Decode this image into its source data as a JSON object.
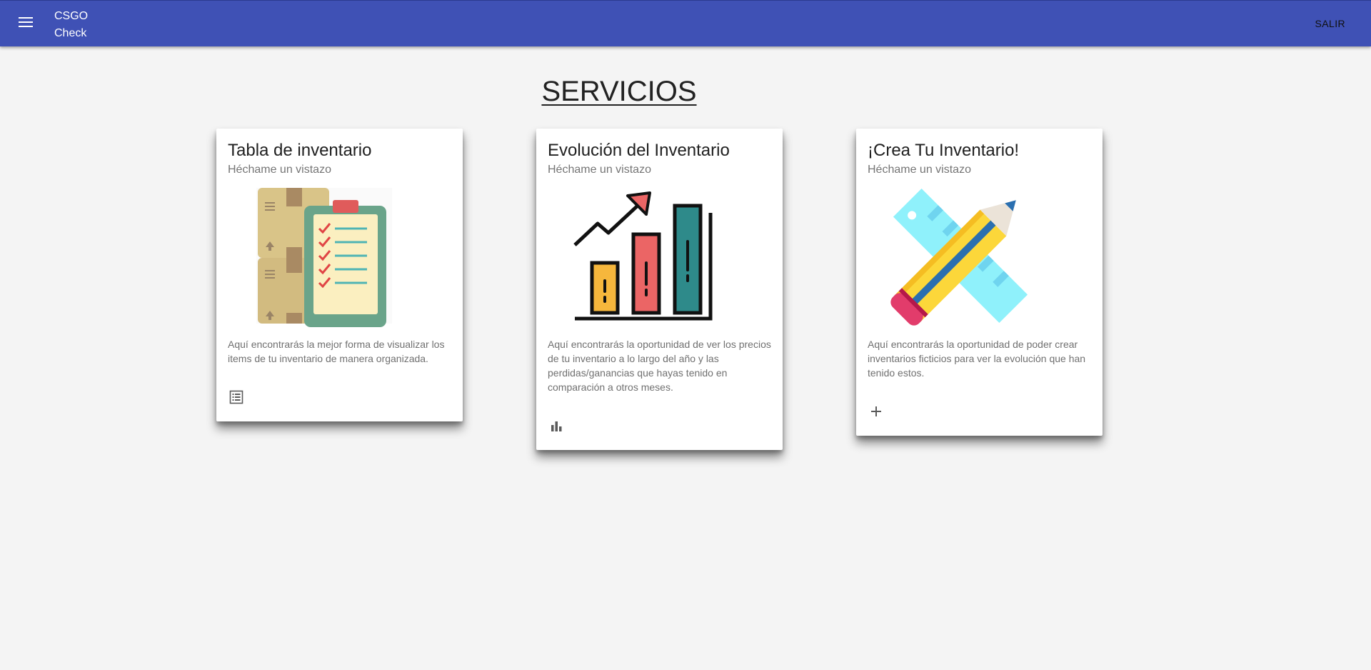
{
  "app": {
    "brand_line1": "CSGO",
    "brand_line2": "Check",
    "logout_label": "SALIR",
    "primary_color": "#3f51b5"
  },
  "page": {
    "title": "SERVICIOS"
  },
  "cards": [
    {
      "title": "Tabla de inventario",
      "subtitle": "Héchame un vistazo",
      "description": "Aquí encontrarás la mejor forma de visualizar los items de tu inventario de manera organizada.",
      "image": "boxes-clipboard-checklist",
      "action_icon": "list-icon"
    },
    {
      "title": "Evolución del Inventario",
      "subtitle": "Héchame un vistazo",
      "description": "Aquí encontrarás la oportunidad de ver los precios de tu inventario a lo largo del año y las perdidas/ganancias que hayas tenido en comparación a otros meses.",
      "image": "growth-bar-chart",
      "action_icon": "bar-chart-icon"
    },
    {
      "title": "¡Crea Tu Inventario!",
      "subtitle": "Héchame un vistazo",
      "description": "Aquí encontrarás la oportunidad de poder crear inventarios ficticios para ver la evolución que han tenido estos.",
      "image": "pencil-ruler",
      "action_icon": "plus-icon"
    }
  ]
}
